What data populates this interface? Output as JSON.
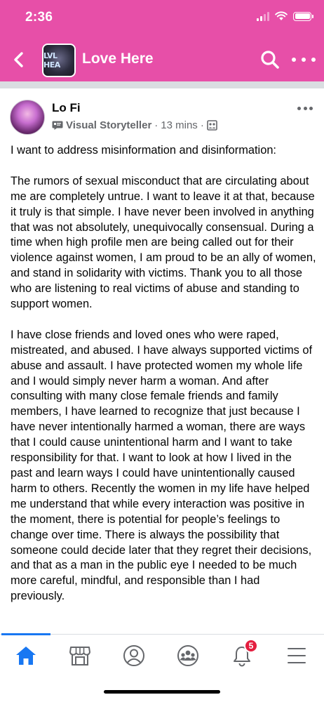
{
  "status_bar": {
    "time": "2:36"
  },
  "header": {
    "group_title": "Love Here",
    "group_avatar_text": "LVL HEA",
    "back_icon": "chevron-left-icon",
    "search_icon": "search-icon",
    "more_icon": "more-horizontal-icon",
    "background_color": "#e74fa8"
  },
  "post": {
    "author": "Lo Fi",
    "badge_label": "Visual Storyteller",
    "separator": "·",
    "time": "13 mins",
    "audience_icon": "group-audience-icon",
    "paragraphs": [
      "I want to address misinformation and disinformation:",
      "The rumors of sexual misconduct that are circulating about me are completely untrue. I want to leave it at that, because it truly is that simple. I have never been involved in anything that was not absolutely, unequivocally consensual. During a time when high profile men are being called out for their violence against women, I am proud to be an ally of women, and stand in solidarity with victims. Thank you to all those who are listening to real victims of abuse and standing to support women.",
      "I have close friends and loved ones who were raped, mistreated, and abused. I have always supported victims of abuse and assault. I have protected women my whole life and I would simply never harm a woman. And after consulting with many close female friends and family members, I have learned to recognize that just because I have never intentionally harmed a woman, there are ways that I could cause unintentional harm and I want to take responsibility for that. I want to look at how I lived in the past and learn ways I could have unintentionally caused harm to others. Recently the women in my life have helped me understand that while every interaction was positive in the moment, there is potential for people’s feelings to change over time. There is always the possibility that someone could decide later that they regret their decisions, and that as a man in the public eye I needed to be much more careful, mindful, and responsible than I had previously."
    ]
  },
  "tabbar": {
    "tabs": [
      {
        "icon": "home-icon",
        "active": true
      },
      {
        "icon": "marketplace-icon",
        "active": false
      },
      {
        "icon": "profile-icon",
        "active": false
      },
      {
        "icon": "groups-icon",
        "active": false
      },
      {
        "icon": "bell-icon",
        "active": false,
        "badge": "5"
      },
      {
        "icon": "menu-icon",
        "active": false
      }
    ],
    "active_color": "#1877f2",
    "inactive_color": "#65676b"
  }
}
